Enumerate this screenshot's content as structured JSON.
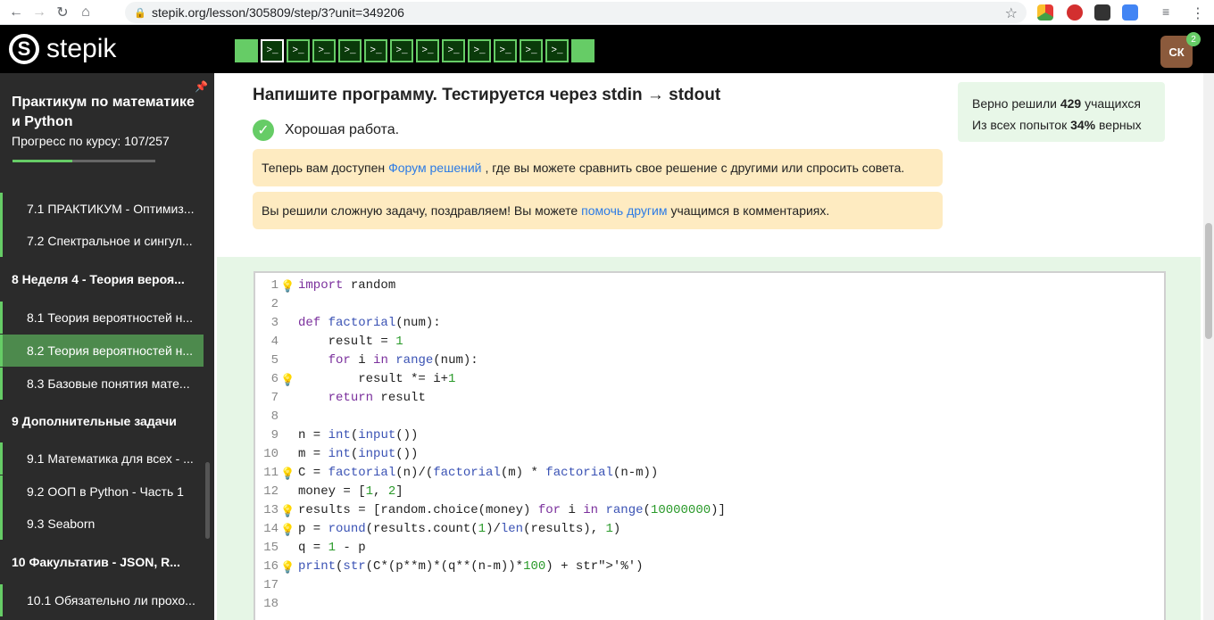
{
  "browser": {
    "url": "stepik.org/lesson/305809/step/3?unit=349206"
  },
  "header": {
    "logo_text": "stepik",
    "step_count": 14,
    "current_step": 2,
    "avatar_initials": "СК",
    "notification_count": "2"
  },
  "sidebar": {
    "course_title": "Практикум по математике и Python",
    "progress_label": "Прогресс по курсу:  107/257",
    "progress_fraction": 0.42,
    "items": [
      {
        "label": "7.1  ПРАКТИКУМ - Оптимиз...",
        "type": "sub",
        "active": false
      },
      {
        "label": "7.2  Спектральное и сингул...",
        "type": "sub",
        "active": false
      },
      {
        "label": "8  Неделя 4 - Теория вероя...",
        "type": "section",
        "active": false
      },
      {
        "label": "8.1  Теория вероятностей н...",
        "type": "sub",
        "active": false
      },
      {
        "label": "8.2  Теория вероятностей н...",
        "type": "sub",
        "active": true
      },
      {
        "label": "8.3  Базовые понятия мате...",
        "type": "sub",
        "active": false
      },
      {
        "label": "9  Дополнительные задачи",
        "type": "section",
        "active": false
      },
      {
        "label": "9.1  Математика для всех - ...",
        "type": "sub",
        "active": false
      },
      {
        "label": "9.2  ООП в Python - Часть 1",
        "type": "sub",
        "active": false
      },
      {
        "label": "9.3  Seaborn",
        "type": "sub",
        "active": false
      },
      {
        "label": "10  Факультатив - JSON, R...",
        "type": "section",
        "active": false
      },
      {
        "label": "10.1  Обязательно ли прохо...",
        "type": "sub",
        "active": false
      }
    ]
  },
  "main": {
    "title": "Напишите программу. Тестируется через stdin → stdout",
    "success_text": "Хорошая работа.",
    "hint1_before": "Теперь вам доступен",
    "hint1_link": "Форум решений",
    "hint1_after": ", где вы можете сравнить свое решение с другими или спросить совета.",
    "hint2_before": "Вы решили сложную задачу, поздравляем! Вы можете",
    "hint2_link": "помочь другим",
    "hint2_after": "учащимся в комментариях.",
    "stats_solved_before": "Верно решили",
    "stats_solved_num": "429",
    "stats_solved_after": "учащихся",
    "stats_attempts_before": "Из всех попыток",
    "stats_attempts_num": "34%",
    "stats_attempts_after": "верных"
  },
  "code": [
    {
      "n": "1",
      "bulb": true,
      "text": "import random"
    },
    {
      "n": "2",
      "bulb": false,
      "text": ""
    },
    {
      "n": "3",
      "bulb": false,
      "text": "def factorial(num):"
    },
    {
      "n": "4",
      "bulb": false,
      "text": "    result = 1"
    },
    {
      "n": "5",
      "bulb": false,
      "text": "    for i in range(num):"
    },
    {
      "n": "6",
      "bulb": true,
      "text": "        result *= i+1"
    },
    {
      "n": "7",
      "bulb": false,
      "text": "    return result"
    },
    {
      "n": "8",
      "bulb": false,
      "text": ""
    },
    {
      "n": "9",
      "bulb": false,
      "text": "n = int(input())"
    },
    {
      "n": "10",
      "bulb": false,
      "text": "m = int(input())"
    },
    {
      "n": "11",
      "bulb": true,
      "text": "C = factorial(n)/(factorial(m) * factorial(n-m))"
    },
    {
      "n": "12",
      "bulb": false,
      "text": "money = [1, 2]"
    },
    {
      "n": "13",
      "bulb": true,
      "text": "results = [random.choice(money) for i in range(10000000)]"
    },
    {
      "n": "14",
      "bulb": true,
      "text": "p = round(results.count(1)/len(results), 1)"
    },
    {
      "n": "15",
      "bulb": false,
      "text": "q = 1 - p"
    },
    {
      "n": "16",
      "bulb": true,
      "text": "print(str(C*(p**m)*(q**(n-m))*100) + '%')"
    },
    {
      "n": "17",
      "bulb": false,
      "text": ""
    },
    {
      "n": "18",
      "bulb": false,
      "text": ""
    }
  ]
}
